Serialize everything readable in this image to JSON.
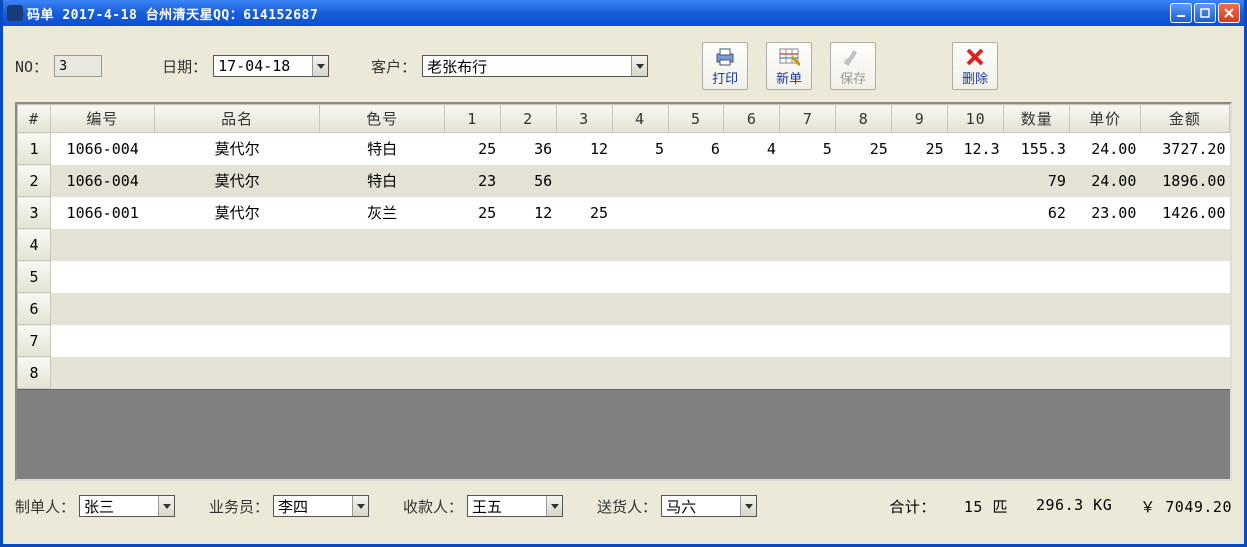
{
  "titlebar": "码单 2017-4-18  台州清天星QQ：614152687",
  "top": {
    "no_label": "NO：",
    "no_value": "3",
    "date_label": "日期：",
    "date_value": "17-04-18",
    "cust_label": "客户：",
    "cust_value": "老张布行"
  },
  "toolbar": {
    "print": "打印",
    "new": "新单",
    "save": "保存",
    "delete": "删除"
  },
  "headers": {
    "idx": "#",
    "code": "编号",
    "name": "品名",
    "color": "色号",
    "c1": "1",
    "c2": "2",
    "c3": "3",
    "c4": "4",
    "c5": "5",
    "c6": "6",
    "c7": "7",
    "c8": "8",
    "c9": "9",
    "c10": "10",
    "qty": "数量",
    "price": "单价",
    "amount": "金额"
  },
  "rows": [
    {
      "n": "1",
      "code": "1066-004",
      "name": "莫代尔",
      "color": "特白",
      "v": [
        "25",
        "36",
        "12",
        "5",
        "6",
        "4",
        "5",
        "25",
        "25",
        "12.3"
      ],
      "qty": "155.3",
      "price": "24.00",
      "amount": "3727.20"
    },
    {
      "n": "2",
      "code": "1066-004",
      "name": "莫代尔",
      "color": "特白",
      "v": [
        "23",
        "56",
        "",
        "",
        "",
        "",
        "",
        "",
        "",
        ""
      ],
      "qty": "79",
      "price": "24.00",
      "amount": "1896.00"
    },
    {
      "n": "3",
      "code": "1066-001",
      "name": "莫代尔",
      "color": "灰兰",
      "v": [
        "25",
        "12",
        "25",
        "",
        "",
        "",
        "",
        "",
        "",
        ""
      ],
      "qty": "62",
      "price": "23.00",
      "amount": "1426.00"
    },
    {
      "n": "4",
      "code": "",
      "name": "",
      "color": "",
      "v": [
        "",
        "",
        "",
        "",
        "",
        "",
        "",
        "",
        "",
        ""
      ],
      "qty": "",
      "price": "",
      "amount": ""
    },
    {
      "n": "5",
      "code": "",
      "name": "",
      "color": "",
      "v": [
        "",
        "",
        "",
        "",
        "",
        "",
        "",
        "",
        "",
        ""
      ],
      "qty": "",
      "price": "",
      "amount": ""
    },
    {
      "n": "6",
      "code": "",
      "name": "",
      "color": "",
      "v": [
        "",
        "",
        "",
        "",
        "",
        "",
        "",
        "",
        "",
        ""
      ],
      "qty": "",
      "price": "",
      "amount": ""
    },
    {
      "n": "7",
      "code": "",
      "name": "",
      "color": "",
      "v": [
        "",
        "",
        "",
        "",
        "",
        "",
        "",
        "",
        "",
        ""
      ],
      "qty": "",
      "price": "",
      "amount": ""
    },
    {
      "n": "8",
      "code": "",
      "name": "",
      "color": "",
      "v": [
        "",
        "",
        "",
        "",
        "",
        "",
        "",
        "",
        "",
        ""
      ],
      "qty": "",
      "price": "",
      "amount": ""
    }
  ],
  "bottom": {
    "maker_label": "制单人：",
    "maker": "张三",
    "sales_label": "业务员：",
    "sales": "李四",
    "cashier_label": "收款人：",
    "cashier": "王五",
    "shipper_label": "送货人：",
    "shipper": "马六",
    "total_label": "合计：",
    "pieces": "15 匹",
    "weight": "296.3 KG",
    "money": "￥ 7049.20"
  }
}
